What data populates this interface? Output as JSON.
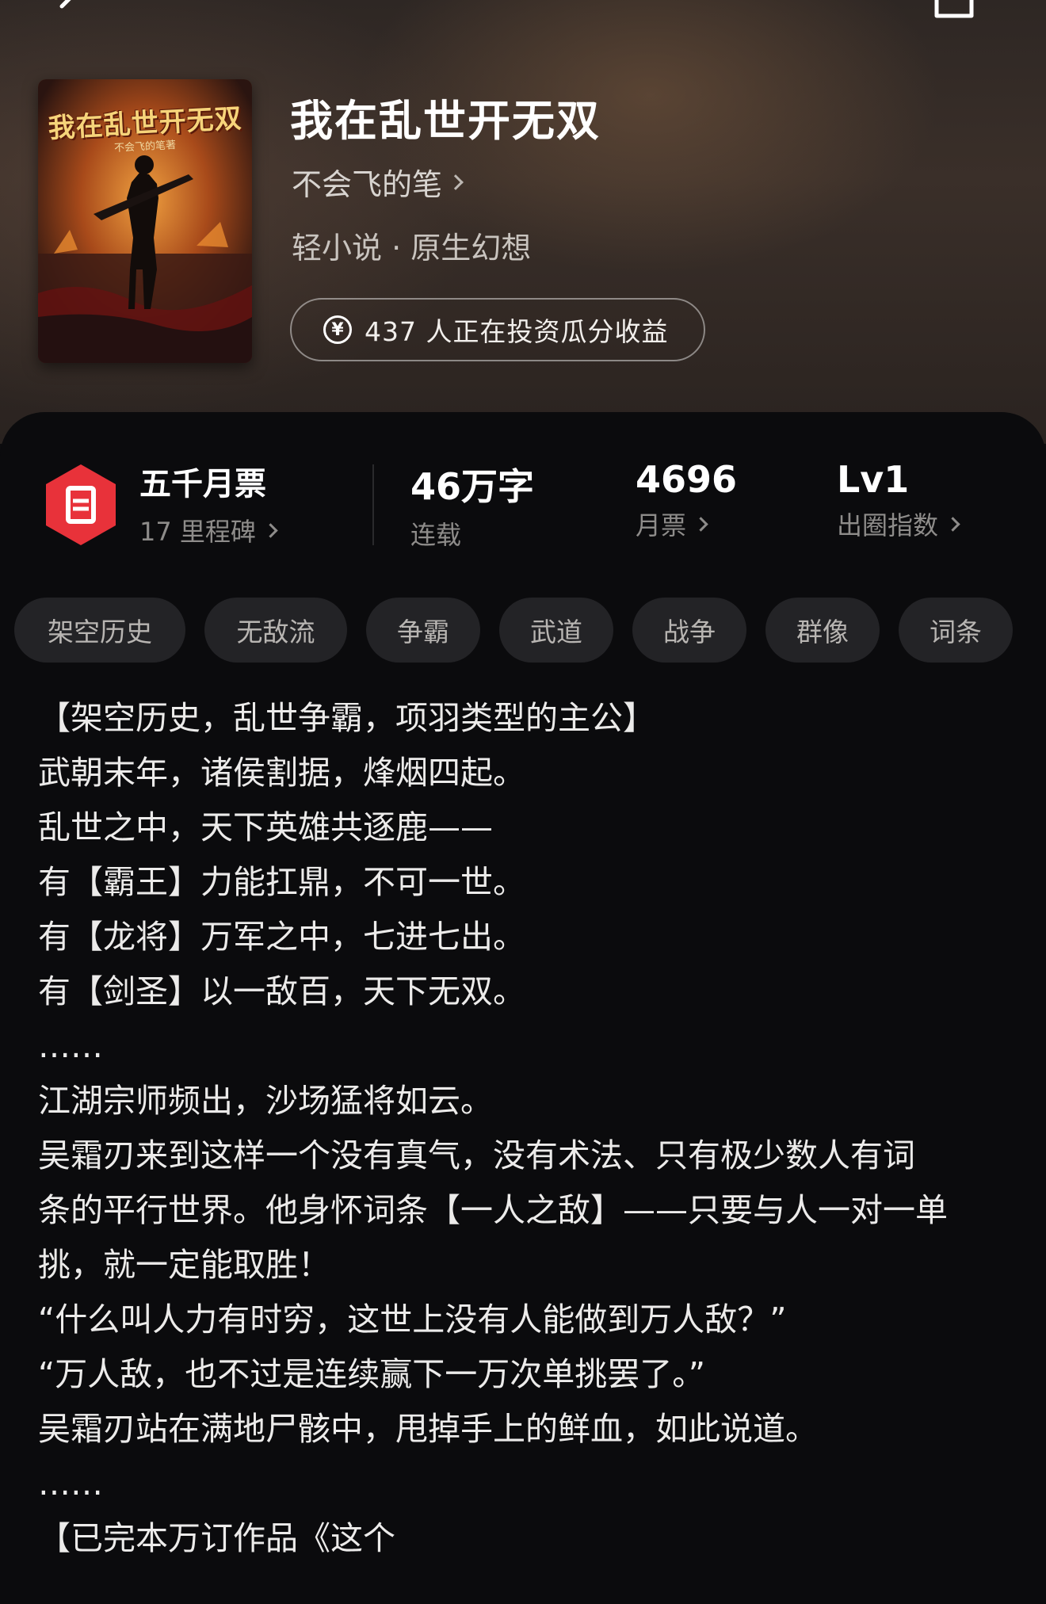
{
  "book": {
    "cover_title": "我在乱世开无双",
    "cover_author": "不会飞的笔著",
    "title": "我在乱世开无双",
    "author": "不会飞的笔",
    "genre": "轻小说 · 原生幻想",
    "investors": "437 人正在投资瓜分收益"
  },
  "stats": {
    "ticket": {
      "main": "五千月票",
      "sub": "17 里程碑"
    },
    "words": {
      "main": "46万字",
      "sub": "连载"
    },
    "votes": {
      "main": "4696",
      "sub": "月票"
    },
    "level": {
      "main": "Lv1",
      "sub": "出圈指数"
    }
  },
  "tags": [
    "架空历史",
    "无敌流",
    "争霸",
    "武道",
    "战争",
    "群像",
    "词条"
  ],
  "synopsis": [
    "【架空历史，乱世争霸，项羽类型的主公】",
    "武朝末年，诸侯割据，烽烟四起。",
    "乱世之中，天下英雄共逐鹿——",
    "有【霸王】力能扛鼎，不可一世。",
    "有【龙将】万军之中，七进七出。",
    "有【剑圣】以一敌百，天下无双。",
    "……",
    "江湖宗师频出，沙场猛将如云。",
    "吴霜刃来到这样一个没有真气，没有术法、只有极少数人有词",
    "条的平行世界。他身怀词条【一人之敌】——只要与人一对一单",
    "挑，就一定能取胜！",
    "“什么叫人力有时穷，这世上没有人能做到万人敌？”",
    "“万人敌，也不过是连续赢下一万次单挑罢了。”",
    "吴霜刃站在满地尸骸中，甩掉手上的鲜血，如此说道。",
    "……",
    "【已完本万订作品《这个"
  ],
  "colors": {
    "accent": "#e8323a",
    "panel": "#0b0b0d",
    "tag_bg": "#232326"
  }
}
